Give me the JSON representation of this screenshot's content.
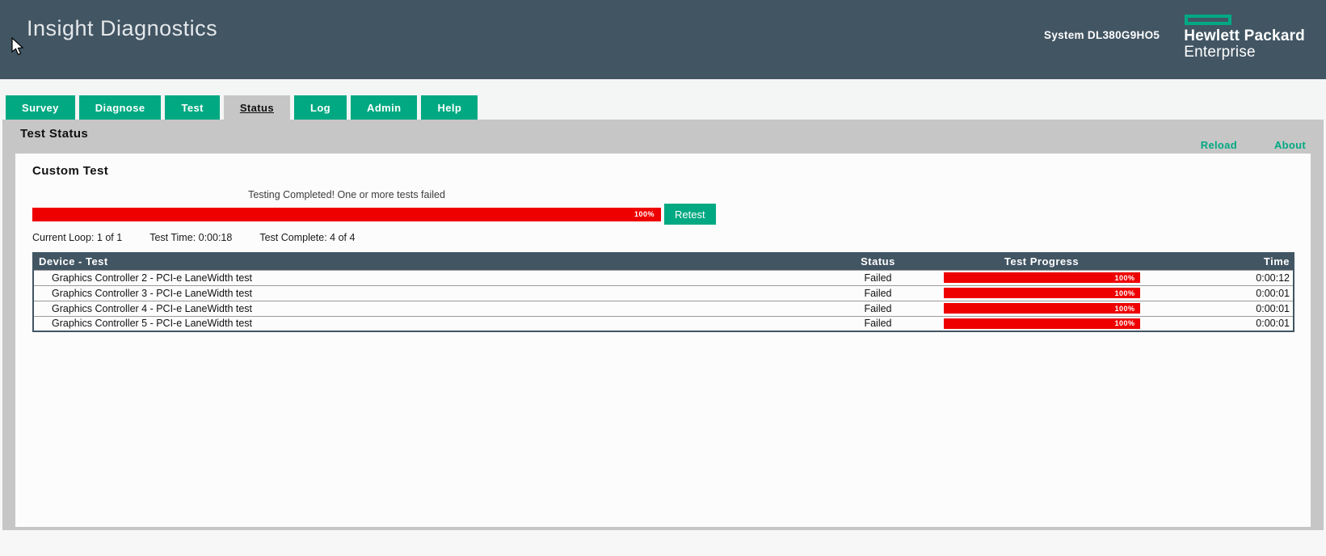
{
  "header": {
    "app_title": "Insight Diagnostics",
    "system_label": "System",
    "system_value": "DL380G9HO5",
    "brand_line1": "Hewlett Packard",
    "brand_line2": "Enterprise"
  },
  "tabs": [
    {
      "label": "Survey",
      "active": false
    },
    {
      "label": "Diagnose",
      "active": false
    },
    {
      "label": "Test",
      "active": false
    },
    {
      "label": "Status",
      "active": true
    },
    {
      "label": "Log",
      "active": false
    },
    {
      "label": "Admin",
      "active": false
    },
    {
      "label": "Help",
      "active": false
    }
  ],
  "title_bar": {
    "title": "Test Status",
    "links": [
      "Reload",
      "About"
    ]
  },
  "main": {
    "section_title": "Custom Test",
    "progress": {
      "message": "Testing Completed! One or more tests failed",
      "percent_label": "100%",
      "retest_label": "Retest"
    },
    "stats": [
      "Current Loop: 1 of 1",
      "Test Time: 0:00:18",
      "Test Complete: 4 of 4"
    ]
  },
  "table": {
    "columns": [
      "Device - Test",
      "Status",
      "Test Progress",
      "Time"
    ],
    "rows": [
      {
        "device": "Graphics Controller 2 - PCI-e LaneWidth test",
        "status": "Failed",
        "progress": "100%",
        "time": "0:00:12"
      },
      {
        "device": "Graphics Controller 3 - PCI-e LaneWidth test",
        "status": "Failed",
        "progress": "100%",
        "time": "0:00:01"
      },
      {
        "device": "Graphics Controller 4 - PCI-e LaneWidth test",
        "status": "Failed",
        "progress": "100%",
        "time": "0:00:01"
      },
      {
        "device": "Graphics Controller 5 - PCI-e LaneWidth test",
        "status": "Failed",
        "progress": "100%",
        "time": "0:00:01"
      }
    ]
  },
  "colors": {
    "brand_green": "#01a982",
    "header_slate": "#425563",
    "fail_red": "#ee0000",
    "bar_gray": "#c6c6c6"
  }
}
